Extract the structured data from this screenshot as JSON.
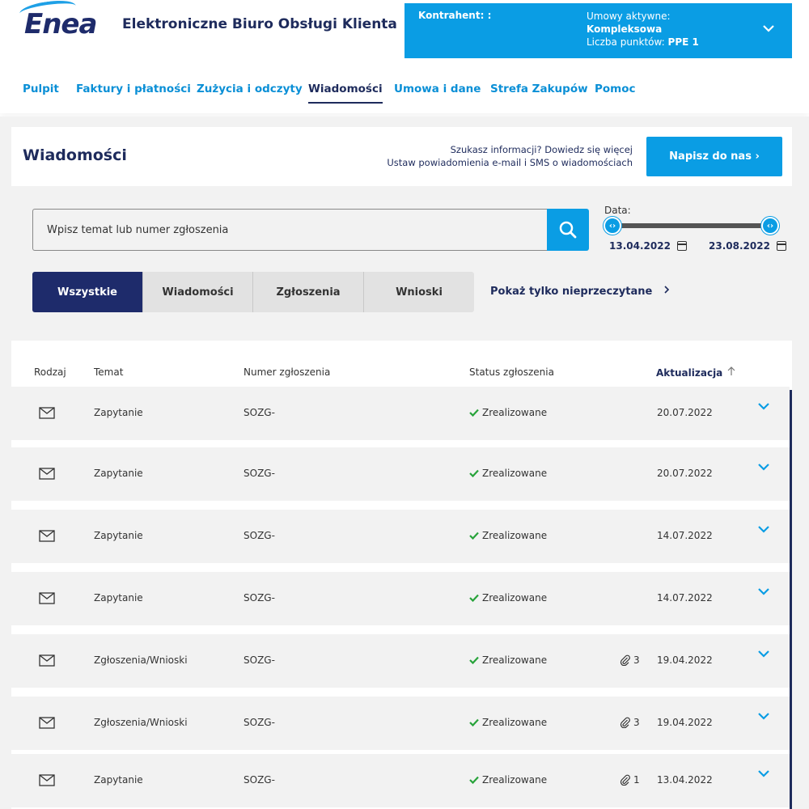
{
  "header": {
    "logo": "Enea",
    "title": "Elektroniczne Biuro Obsługi Klienta",
    "kontrahent_label": "Kontrahent: :",
    "umowy_label": "Umowy aktywne:",
    "umowy_value": "Kompleksowa",
    "punkty_label": "Liczba punktów: ",
    "punkty_value": "PPE 1"
  },
  "nav": {
    "items": [
      "Pulpit",
      "Faktury i płatności",
      "Zużycia i odczyty",
      "Wiadomości",
      "Umowa i dane",
      "Strefa Zakupów",
      "Pomoc"
    ],
    "active": "Wiadomości"
  },
  "page": {
    "title": "Wiadomości",
    "info_line1": "Szukasz informacji? Dowiedz się więcej",
    "info_line2": "Ustaw powiadomienia e-mail i SMS o wiadomościach",
    "write_button": "Napisz do nas ›"
  },
  "search": {
    "placeholder": "Wpisz temat lub numer zgłoszenia",
    "value": ""
  },
  "date_filter": {
    "label": "Data:",
    "from": "13.04.2022",
    "to": "23.08.2022"
  },
  "tabs": {
    "items": [
      "Wszystkie",
      "Wiadomości",
      "Zgłoszenia",
      "Wnioski"
    ],
    "active": "Wszystkie",
    "unread_link": "Pokaż tylko nieprzeczytane"
  },
  "table": {
    "headers": {
      "rodzaj": "Rodzaj",
      "temat": "Temat",
      "numer": "Numer zgłoszenia",
      "status": "Status zgłoszenia",
      "aktualizacja": "Aktualizacja"
    },
    "rows": [
      {
        "temat": "Zapytanie",
        "numer": "SOZG-",
        "status": "Zrealizowane",
        "attachments": "",
        "date": "20.07.2022"
      },
      {
        "temat": "Zapytanie",
        "numer": "SOZG-",
        "status": "Zrealizowane",
        "attachments": "",
        "date": "20.07.2022"
      },
      {
        "temat": "Zapytanie",
        "numer": "SOZG-",
        "status": "Zrealizowane",
        "attachments": "",
        "date": "14.07.2022"
      },
      {
        "temat": "Zapytanie",
        "numer": "SOZG-",
        "status": "Zrealizowane",
        "attachments": "",
        "date": "14.07.2022"
      },
      {
        "temat": "Zgłoszenia/Wnioski",
        "numer": "SOZG-",
        "status": "Zrealizowane",
        "attachments": "3",
        "date": "19.04.2022"
      },
      {
        "temat": "Zgłoszenia/Wnioski",
        "numer": "SOZG-",
        "status": "Zrealizowane",
        "attachments": "3",
        "date": "19.04.2022"
      },
      {
        "temat": "Zapytanie",
        "numer": "SOZG-",
        "status": "Zrealizowane",
        "attachments": "1",
        "date": "13.04.2022"
      }
    ]
  },
  "colors": {
    "brand_blue": "#0a9de4",
    "navy": "#1e2b5c",
    "success": "#27a33a"
  },
  "icons": [
    "search-icon",
    "calendar-icon",
    "mail-icon",
    "paperclip-icon",
    "chevron-down-icon",
    "check-icon",
    "sort-arrow-up-icon"
  ]
}
